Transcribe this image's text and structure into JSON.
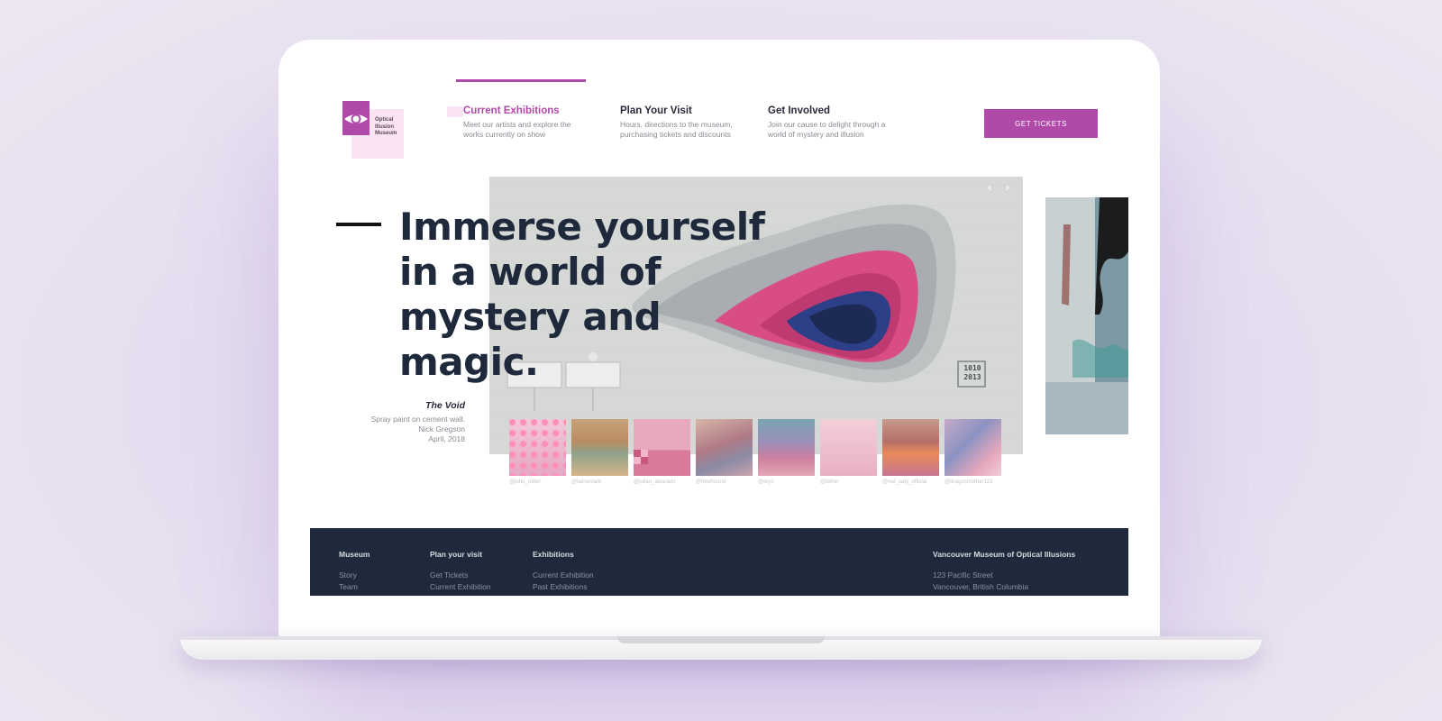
{
  "logo": {
    "name_line1": "Optical",
    "name_line2": "Illusion",
    "name_line3": "Museum"
  },
  "nav": {
    "items": [
      {
        "title": "Current Exhibitions",
        "desc": "Meet our artists and explore the works currently on show",
        "active": true
      },
      {
        "title": "Plan Your Visit",
        "desc": "Hours, directions to the museum, purchasing tickets and discounts",
        "active": false
      },
      {
        "title": "Get Involved",
        "desc": "Join our cause to delight through a world of mystery and illusion",
        "active": false
      }
    ],
    "tickets_label": "GET TICKETS"
  },
  "hero": {
    "headline": "Immerse yourself in a world of mystery and magic.",
    "prev_arrow": "‹",
    "next_arrow": "›",
    "wall_tag_line1": "1010",
    "wall_tag_line2": "2013"
  },
  "artwork": {
    "title": "The Void",
    "medium": "Spray paint on cement wall.",
    "artist": "Nick Gregson",
    "date": "April, 2018"
  },
  "thumbnails": [
    {
      "handle": "@john_miller"
    },
    {
      "handle": "@lalinestark"
    },
    {
      "handle": "@julian_alvarado"
    },
    {
      "handle": "@freehound"
    },
    {
      "handle": "@erys"
    },
    {
      "handle": "@bithin"
    },
    {
      "handle": "@red_lady_official"
    },
    {
      "handle": "@dragonmother123"
    }
  ],
  "footer": {
    "museum": {
      "heading": "Museum",
      "links": [
        "Story",
        "Team"
      ]
    },
    "plan": {
      "heading": "Plan your visit",
      "links": [
        "Get Tickets",
        "Current Exhibition"
      ]
    },
    "exhibitions": {
      "heading": "Exhibitions",
      "links": [
        "Current Exhibition",
        "Past Exhibitions"
      ]
    },
    "address": {
      "heading": "Vancouver Museum of Optical Illusions",
      "lines": [
        "123 Pacific Street",
        "Vancouver, British Columbia"
      ]
    }
  },
  "colors": {
    "accent": "#b04aa9",
    "accent_light": "#fbe3f6",
    "navy": "#1e2a3c"
  }
}
